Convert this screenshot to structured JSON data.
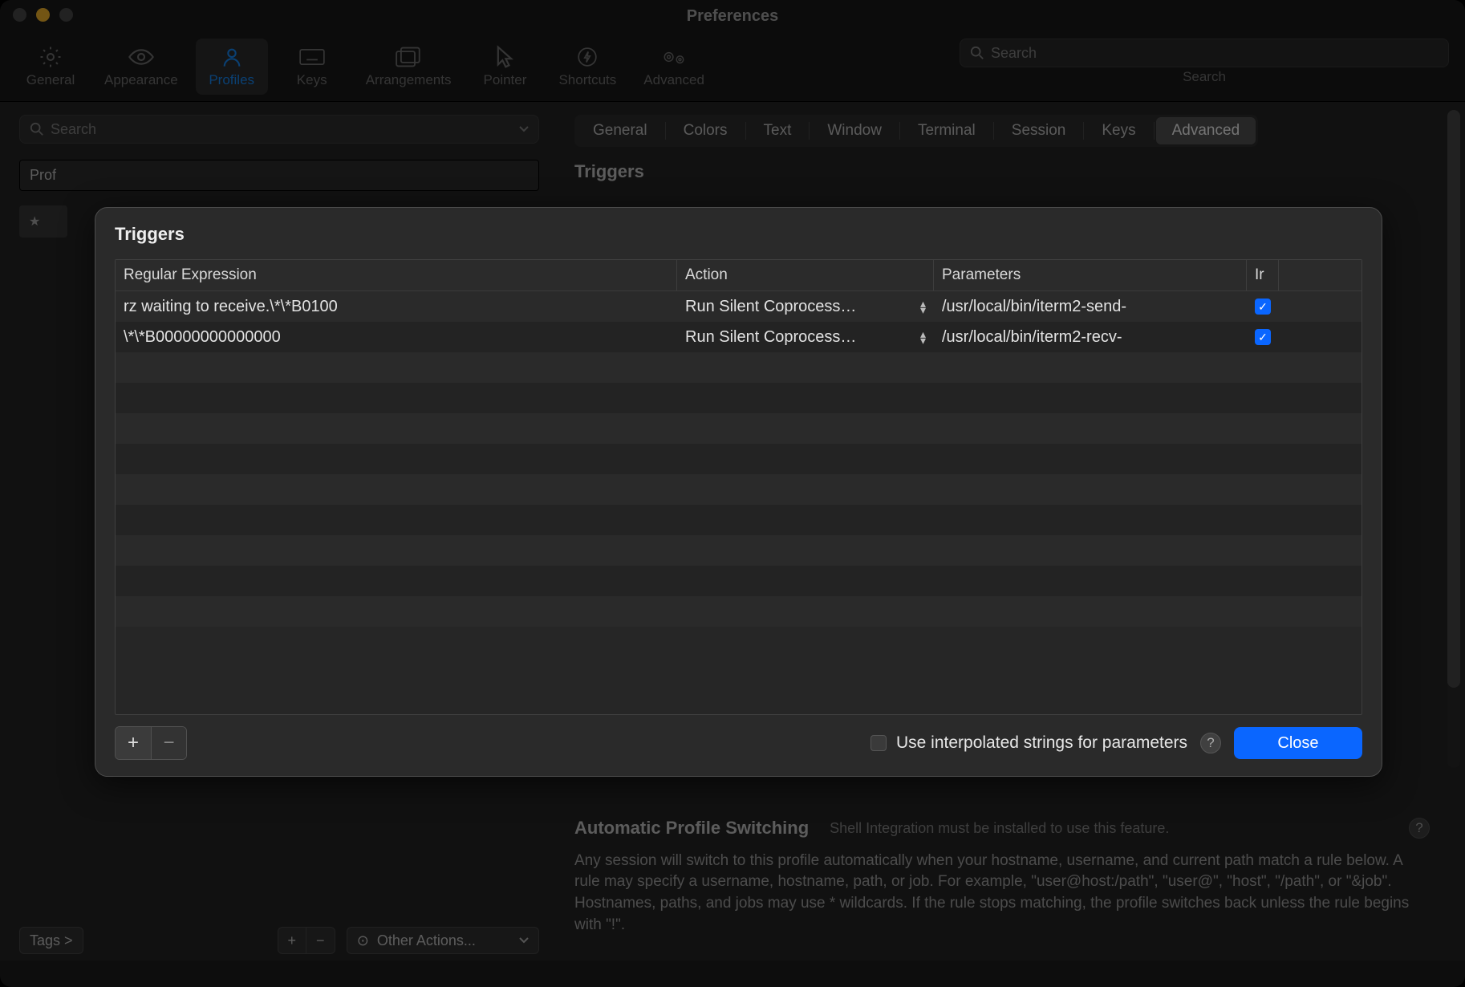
{
  "window": {
    "title": "Preferences"
  },
  "toolbar": {
    "items": [
      {
        "label": "General"
      },
      {
        "label": "Appearance"
      },
      {
        "label": "Profiles"
      },
      {
        "label": "Keys"
      },
      {
        "label": "Arrangements"
      },
      {
        "label": "Pointer"
      },
      {
        "label": "Shortcuts"
      },
      {
        "label": "Advanced"
      }
    ],
    "search_placeholder": "Search",
    "search_label": "Search"
  },
  "sidebar": {
    "search_placeholder": "Search",
    "profiles_header": "Prof",
    "tags_label": "Tags >",
    "other_actions_label": "Other Actions..."
  },
  "segmented": {
    "tabs": [
      "General",
      "Colors",
      "Text",
      "Window",
      "Terminal",
      "Session",
      "Keys",
      "Advanced"
    ],
    "active": 7
  },
  "main": {
    "section_title": "Triggers"
  },
  "aps": {
    "heading": "Automatic Profile Switching",
    "hint": "Shell Integration must be installed to use this feature.",
    "body": "Any session will switch to this profile automatically when your hostname, username, and current path match a rule below. A rule may specify a username, hostname, path, or job. For example, \"user@host:/path\", \"user@\", \"host\", \"/path\", or \"&job\". Hostnames, paths, and jobs may use * wildcards. If the rule stops matching, the profile switches back unless the rule begins with \"!\"."
  },
  "popover": {
    "title": "Triggers",
    "columns": {
      "regex": "Regular Expression",
      "action": "Action",
      "params": "Parameters",
      "instant": "Ir"
    },
    "rows": [
      {
        "regex": "rz waiting to receive.\\*\\*B0100",
        "action": "Run Silent Coprocess…",
        "params": "/usr/local/bin/iterm2-send-",
        "instant": true
      },
      {
        "regex": "\\*\\*B00000000000000",
        "action": "Run Silent Coprocess…",
        "params": "/usr/local/bin/iterm2-recv-",
        "instant": true
      }
    ],
    "interp_label": "Use interpolated strings for parameters",
    "interp_checked": false,
    "close_label": "Close"
  }
}
